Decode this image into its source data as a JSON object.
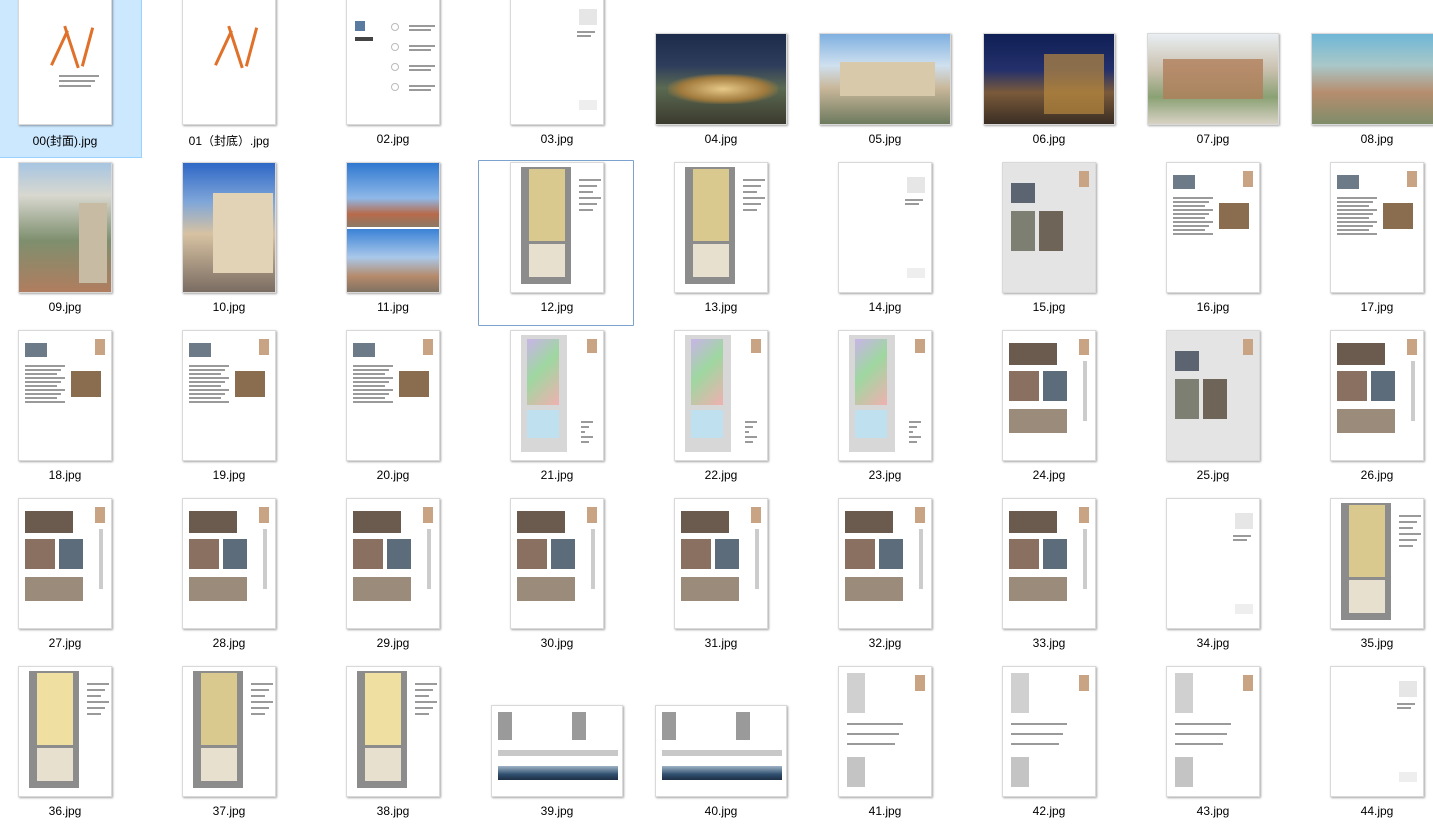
{
  "files": [
    {
      "name": "00(封面).jpg",
      "kind": "cover",
      "selected": true
    },
    {
      "name": "01（封底）.jpg",
      "kind": "cover-back"
    },
    {
      "name": "02.jpg",
      "kind": "contents"
    },
    {
      "name": "03.jpg",
      "kind": "divider"
    },
    {
      "name": "04.jpg",
      "kind": "render-night"
    },
    {
      "name": "05.jpg",
      "kind": "render-day"
    },
    {
      "name": "06.jpg",
      "kind": "render-dusk"
    },
    {
      "name": "07.jpg",
      "kind": "render-aerial"
    },
    {
      "name": "08.jpg",
      "kind": "render-aerial2"
    },
    {
      "name": "09.jpg",
      "kind": "render-portrait"
    },
    {
      "name": "10.jpg",
      "kind": "render-portrait2"
    },
    {
      "name": "11.jpg",
      "kind": "render-split"
    },
    {
      "name": "12.jpg",
      "kind": "plan",
      "focused": true
    },
    {
      "name": "13.jpg",
      "kind": "plan"
    },
    {
      "name": "14.jpg",
      "kind": "divider"
    },
    {
      "name": "15.jpg",
      "kind": "gray-page"
    },
    {
      "name": "16.jpg",
      "kind": "text-page"
    },
    {
      "name": "17.jpg",
      "kind": "text-page"
    },
    {
      "name": "18.jpg",
      "kind": "text-page"
    },
    {
      "name": "19.jpg",
      "kind": "text-page"
    },
    {
      "name": "20.jpg",
      "kind": "text-page"
    },
    {
      "name": "21.jpg",
      "kind": "plan-color"
    },
    {
      "name": "22.jpg",
      "kind": "plan-color"
    },
    {
      "name": "23.jpg",
      "kind": "plan-color"
    },
    {
      "name": "24.jpg",
      "kind": "photo-page"
    },
    {
      "name": "25.jpg",
      "kind": "gray-page"
    },
    {
      "name": "26.jpg",
      "kind": "photo-page"
    },
    {
      "name": "27.jpg",
      "kind": "photo-page"
    },
    {
      "name": "28.jpg",
      "kind": "photo-page"
    },
    {
      "name": "29.jpg",
      "kind": "photo-page"
    },
    {
      "name": "30.jpg",
      "kind": "photo-page"
    },
    {
      "name": "31.jpg",
      "kind": "photo-page"
    },
    {
      "name": "32.jpg",
      "kind": "photo-page"
    },
    {
      "name": "33.jpg",
      "kind": "photo-page"
    },
    {
      "name": "34.jpg",
      "kind": "divider"
    },
    {
      "name": "35.jpg",
      "kind": "plan"
    },
    {
      "name": "36.jpg",
      "kind": "plan-yellow"
    },
    {
      "name": "37.jpg",
      "kind": "plan"
    },
    {
      "name": "38.jpg",
      "kind": "plan-yellow"
    },
    {
      "name": "39.jpg",
      "kind": "landscape"
    },
    {
      "name": "40.jpg",
      "kind": "landscape"
    },
    {
      "name": "41.jpg",
      "kind": "elevation"
    },
    {
      "name": "42.jpg",
      "kind": "elevation"
    },
    {
      "name": "43.jpg",
      "kind": "elevation"
    },
    {
      "name": "44.jpg",
      "kind": "divider"
    }
  ],
  "colors": {
    "selection_bg": "#cce8ff",
    "selection_border": "#99d1ff",
    "focus_border": "#7da2ce",
    "accent_orange": "#e0712a"
  }
}
